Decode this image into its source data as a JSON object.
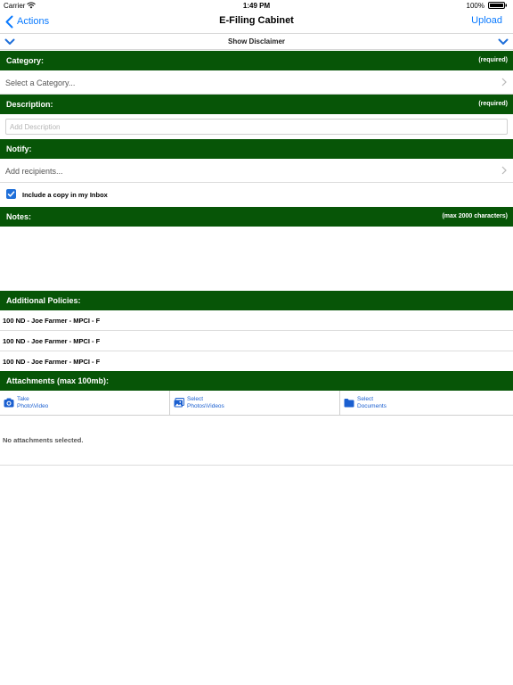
{
  "status_bar": {
    "carrier": "Carrier",
    "time": "1:49 PM",
    "battery_percent": "100%"
  },
  "nav": {
    "back_label": "Actions",
    "title": "E-Filing Cabinet",
    "action_label": "Upload",
    "accent_color": "#0a7aff"
  },
  "disclaimer": {
    "label": "Show Disclaimer"
  },
  "theme": {
    "section_header_bg": "#075507"
  },
  "category": {
    "header": "Category:",
    "hint": "(required)",
    "placeholder": "Select a Category..."
  },
  "description": {
    "header": "Description:",
    "hint": "(required)",
    "placeholder": "Add Description"
  },
  "notify": {
    "header": "Notify:",
    "placeholder": "Add recipients...",
    "inbox_copy_label": "Include a copy in my Inbox",
    "inbox_copy_checked": true
  },
  "notes": {
    "header": "Notes:",
    "hint": "(max 2000 characters)"
  },
  "policies": {
    "header": "Additional Policies:",
    "items": [
      "100 ND - Joe Farmer - MPCI - F",
      "100 ND - Joe Farmer - MPCI - F",
      "100 ND - Joe Farmer - MPCI - F"
    ]
  },
  "attachments": {
    "header": "Attachments (max 100mb):",
    "buttons": [
      {
        "line1": "Take",
        "line2": "Photo\\Video",
        "icon": "camera-icon"
      },
      {
        "line1": "Select",
        "line2": "Photos\\Videos",
        "icon": "photos-icon"
      },
      {
        "line1": "Select",
        "line2": "Documents",
        "icon": "folder-icon"
      }
    ],
    "empty_text": "No attachments selected."
  }
}
